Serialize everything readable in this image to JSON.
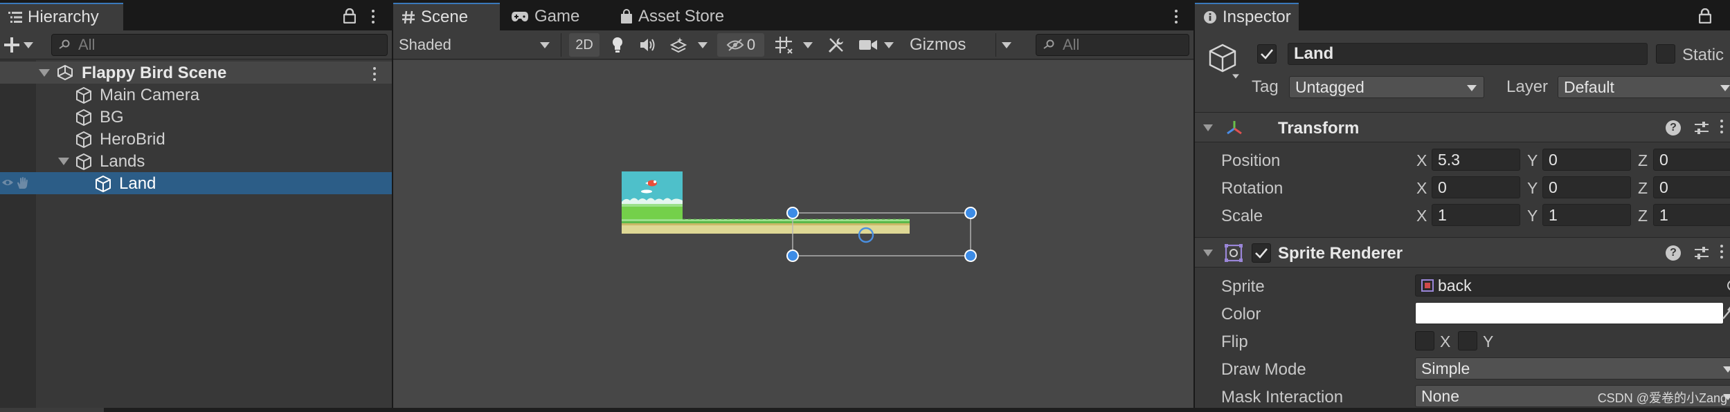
{
  "hierarchy": {
    "tab_label": "Hierarchy",
    "search_placeholder": "All",
    "scene_name": "Flappy Bird Scene",
    "items": [
      {
        "label": "Main Camera"
      },
      {
        "label": "BG"
      },
      {
        "label": "HeroBrid"
      },
      {
        "label": "Lands"
      },
      {
        "label": "Land"
      }
    ]
  },
  "scene": {
    "tabs": [
      {
        "label": "Scene",
        "icon": "hash-icon",
        "active": true
      },
      {
        "label": "Game",
        "icon": "gamepad-icon",
        "active": false
      },
      {
        "label": "Asset Store",
        "icon": "shopping-bag-icon",
        "active": false
      }
    ],
    "toolbar": {
      "shading_mode": "Shaded",
      "mode_2d": "2D",
      "hidden_count": "0",
      "gizmos_label": "Gizmos",
      "search_placeholder": "All"
    }
  },
  "inspector": {
    "tab_label": "Inspector",
    "object_name": "Land",
    "object_active": true,
    "static_label": "Static",
    "tag_label": "Tag",
    "tag_value": "Untagged",
    "layer_label": "Layer",
    "layer_value": "Default",
    "transform": {
      "title": "Transform",
      "position_label": "Position",
      "rotation_label": "Rotation",
      "scale_label": "Scale",
      "axis_x": "X",
      "axis_y": "Y",
      "axis_z": "Z",
      "position": {
        "x": "5.3",
        "y": "0",
        "z": "0"
      },
      "rotation": {
        "x": "0",
        "y": "0",
        "z": "0"
      },
      "scale": {
        "x": "1",
        "y": "1",
        "z": "1"
      }
    },
    "sprite_renderer": {
      "title": "Sprite Renderer",
      "enabled": true,
      "sprite_label": "Sprite",
      "sprite_value": "back",
      "color_label": "Color",
      "color_value": "#ffffff",
      "flip_label": "Flip",
      "flip_x": "X",
      "flip_y": "Y",
      "draw_mode_label": "Draw Mode",
      "draw_mode_value": "Simple",
      "mask_label": "Mask Interaction",
      "mask_value": "None"
    }
  },
  "colors": {
    "selection": "#2c5d87",
    "accent": "#3a79bb",
    "sky": "#4ec0ca",
    "grass": "#74d04a",
    "sand": "#ded895"
  },
  "watermark": "CSDN @爱卷的小Zang"
}
